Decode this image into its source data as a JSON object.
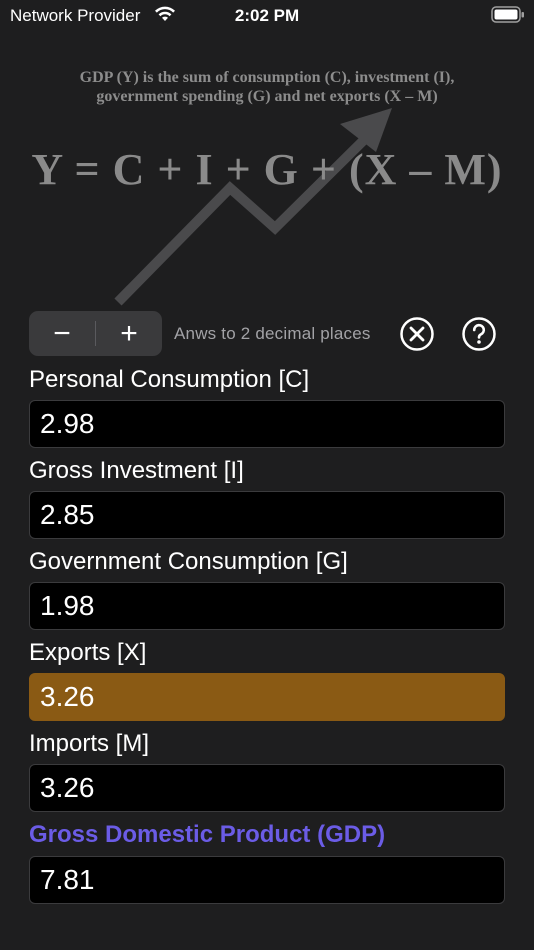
{
  "status_bar": {
    "carrier": "Network Provider",
    "time": "2:02 PM"
  },
  "banner": {
    "line1": "GDP (Y) is the sum of consumption (C), investment (I),",
    "line2": "government spending (G) and net exports (X – M)",
    "formula": "Y = C + I + G + (X – M)"
  },
  "controls": {
    "minus": "−",
    "plus": "+",
    "precision_label": "Anws to 2 decimal places"
  },
  "fields": {
    "consumption": {
      "label": "Personal Consumption [C]",
      "value": "2.98"
    },
    "investment": {
      "label": "Gross Investment [I]",
      "value": "2.85"
    },
    "government": {
      "label": "Government Consumption [G]",
      "value": "1.98"
    },
    "exports": {
      "label": "Exports [X]",
      "value": "3.26"
    },
    "imports": {
      "label": "Imports [M]",
      "value": "3.26"
    },
    "gdp": {
      "label": "Gross Domestic Product (GDP)",
      "value": "7.81"
    }
  },
  "colors": {
    "background": "#1e1e1f",
    "active_field": "#8a5a14",
    "result_label": "#6b5ce6"
  },
  "icons": [
    "wifi-icon",
    "battery-icon",
    "clear-icon",
    "help-icon"
  ]
}
